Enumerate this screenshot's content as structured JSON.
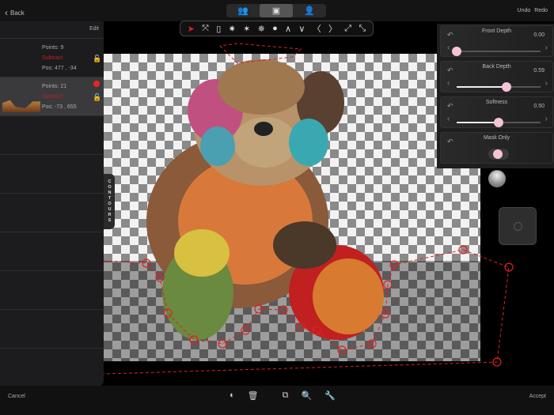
{
  "topbar": {
    "back_label": "Back",
    "undo_label": "Undo",
    "redo_label": "Redo",
    "modes": [
      "person-group-icon",
      "person-foreground-icon",
      "person-icon"
    ],
    "active_mode": 1
  },
  "tools": [
    "pointer-icon",
    "fit-icon",
    "rectangle-icon",
    "star-brush-icon",
    "star-add-icon",
    "star-subtract-icon",
    "add-point-icon",
    "chevron-up-icon",
    "chevron-down-icon",
    "chevron-left-icon",
    "chevron-right-icon",
    "expand-icon",
    "collapse-icon"
  ],
  "left_panel": {
    "edit_label": "Edit",
    "contours": [
      {
        "points_label": "Points:  9",
        "mode": "Subtract",
        "pos": "Pos: 477 , -34"
      },
      {
        "points_label": "Points:  21",
        "mode": "Subtract",
        "pos": "Pos: -73 , 655"
      }
    ],
    "contours_tab": "CONTOURS"
  },
  "panel": {
    "front_depth": {
      "label": "Front Depth",
      "value": "0.00",
      "fraction": 0.0
    },
    "back_depth": {
      "label": "Back Depth",
      "value": "0.59",
      "fraction": 0.59
    },
    "softness": {
      "label": "Softness",
      "value": "0.50",
      "fraction": 0.5
    },
    "mask_only": {
      "label": "Mask Only",
      "on": false
    }
  },
  "bottom": {
    "cancel_label": "Cancel",
    "accept_label": "Accept"
  },
  "colors": {
    "accent_red": "#e02020",
    "knob_pink": "#f4c3d8"
  }
}
